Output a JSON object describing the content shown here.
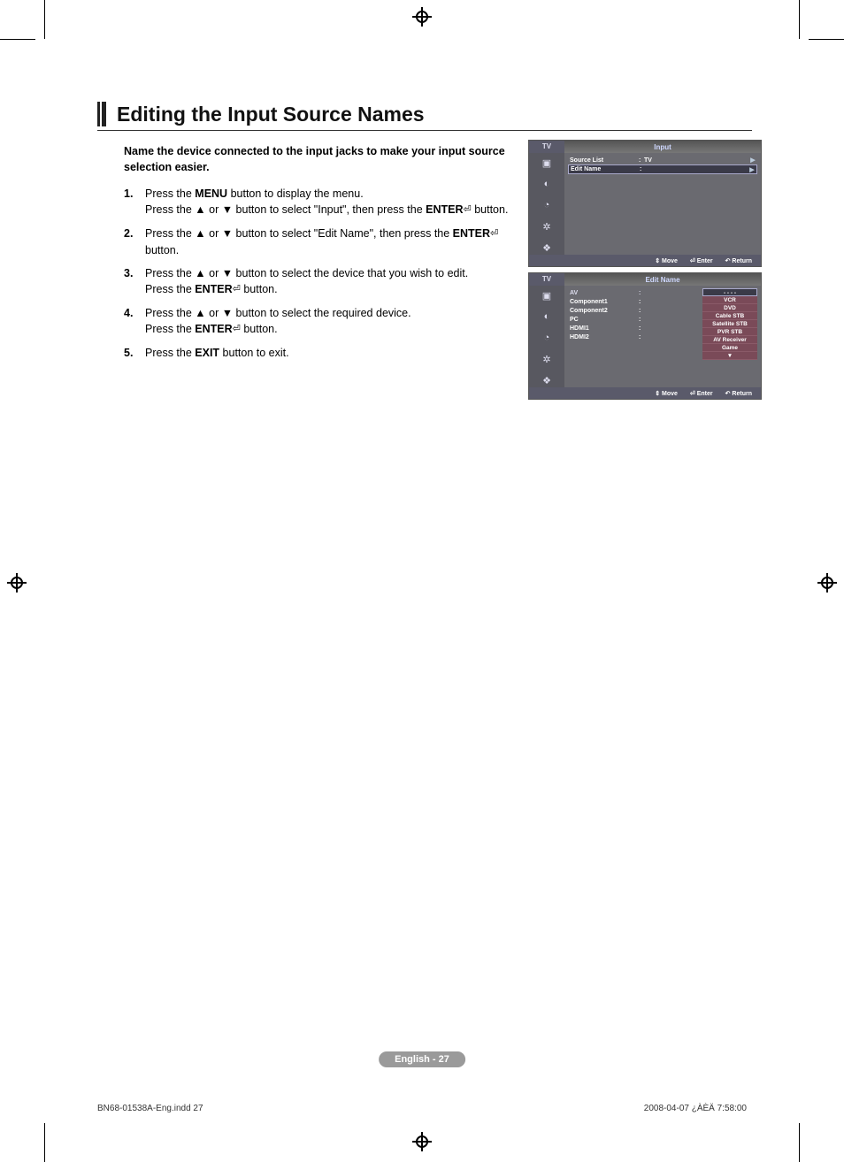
{
  "heading": "Editing the Input Source Names",
  "intro": "Name the device connected to the input jacks to make your input source selection easier.",
  "steps": [
    {
      "num": "1.",
      "html": "Press the <b>MENU</b> button to display the menu.<br>Press the ▲ or ▼ button to select \"Input\", then press the <b>ENTER</b><span class='enter-glyph'>⏎</span> button."
    },
    {
      "num": "2.",
      "html": "Press the ▲ or ▼ button to select \"Edit Name\", then press the <b>ENTER</b><span class='enter-glyph'>⏎</span> button."
    },
    {
      "num": "3.",
      "html": "Press the ▲ or ▼ button to select the device that you wish to edit.<br>Press the <b>ENTER</b><span class='enter-glyph'>⏎</span> button."
    },
    {
      "num": "4.",
      "html": "Press the ▲ or ▼ button to select the required device.<br>Press the <b>ENTER</b><span class='enter-glyph'>⏎</span> button."
    },
    {
      "num": "5.",
      "html": "Press the <b>EXIT</b> button to exit."
    }
  ],
  "osd1": {
    "tv": "TV",
    "title": "Input",
    "rows": [
      {
        "label": "Source List",
        "val": "TV",
        "arrow": "▶",
        "sel": false
      },
      {
        "label": "Edit Name",
        "val": "",
        "arrow": "▶",
        "sel": true
      }
    ],
    "bottom": {
      "move": "Move",
      "enter": "Enter",
      "return": "Return"
    }
  },
  "osd2": {
    "tv": "TV",
    "title": "Edit Name",
    "rows": [
      {
        "label": "AV",
        "colon": ":"
      },
      {
        "label": "Component1",
        "colon": ":"
      },
      {
        "label": "Component2",
        "colon": ":"
      },
      {
        "label": "PC",
        "colon": ":"
      },
      {
        "label": "HDMI1",
        "colon": ":"
      },
      {
        "label": "HDMI2",
        "colon": ":"
      }
    ],
    "options": [
      {
        "label": "- - - -",
        "sel": true
      },
      {
        "label": "VCR",
        "sel": false
      },
      {
        "label": "DVD",
        "sel": false
      },
      {
        "label": "Cable STB",
        "sel": false
      },
      {
        "label": "Satellite STB",
        "sel": false
      },
      {
        "label": "PVR STB",
        "sel": false
      },
      {
        "label": "AV Receiver",
        "sel": false
      },
      {
        "label": "Game",
        "sel": false
      },
      {
        "label": "▼",
        "sel": false,
        "arrow": true
      }
    ],
    "bottom": {
      "move": "Move",
      "enter": "Enter",
      "return": "Return"
    }
  },
  "page_num": "English - 27",
  "footer_left": "BN68-01538A-Eng.indd   27",
  "footer_right": "2008-04-07   ¿ÀÈÄ 7:58:00"
}
